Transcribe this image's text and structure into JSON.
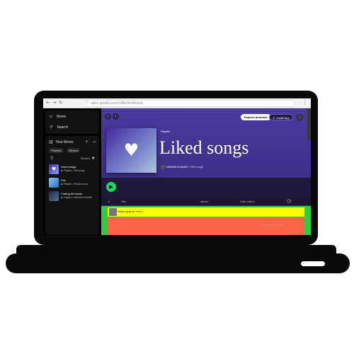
{
  "browser": {
    "url": "open.spotify.com/collection/tracks",
    "back_icon": "arrow-left-icon",
    "forward_icon": "arrow-right-icon",
    "reload_icon": "reload-icon",
    "menu_icon": "kebab-icon"
  },
  "sidebar": {
    "nav": [
      {
        "label": "Home",
        "icon": "home-icon"
      },
      {
        "label": "Search",
        "icon": "search-icon"
      }
    ],
    "library": {
      "title": "Your library",
      "chips": [
        "Playlists",
        "Albums"
      ],
      "sort_label": "Recent",
      "items": [
        {
          "title": "Liked songs",
          "subtitle": "Playlist • 408 songs",
          "color": "#5b3fd1"
        },
        {
          "title": "Pav",
          "subtitle": "Playlist • Pavan kumar",
          "color": "#4fa3d9"
        },
        {
          "title": "Coding bill music",
          "subtitle": "Playlist • NAMAN KUMAR",
          "color": "#2d3a55"
        }
      ]
    }
  },
  "header": {
    "explore_label": "Explore premium",
    "install_label": "Install App"
  },
  "playlist": {
    "type": "Playlist",
    "title": "Liked songs",
    "owner": "NAMAN KUMAR",
    "song_count": "• 255 songs"
  },
  "table": {
    "columns": [
      "#",
      "Title",
      "Album",
      "Date added"
    ],
    "duration_icon": "clock-icon"
  },
  "tracks": [
    {
      "text": "*hasbody(true:\"hov\")"
    }
  ],
  "ghost_text": "Screen Sheet Rom",
  "colors": {
    "accent_green": "#1ed760",
    "hero_purple": "#4c3aa0",
    "highlight_yellow": "#ffff00",
    "highlight_orange": "#ff6347"
  }
}
